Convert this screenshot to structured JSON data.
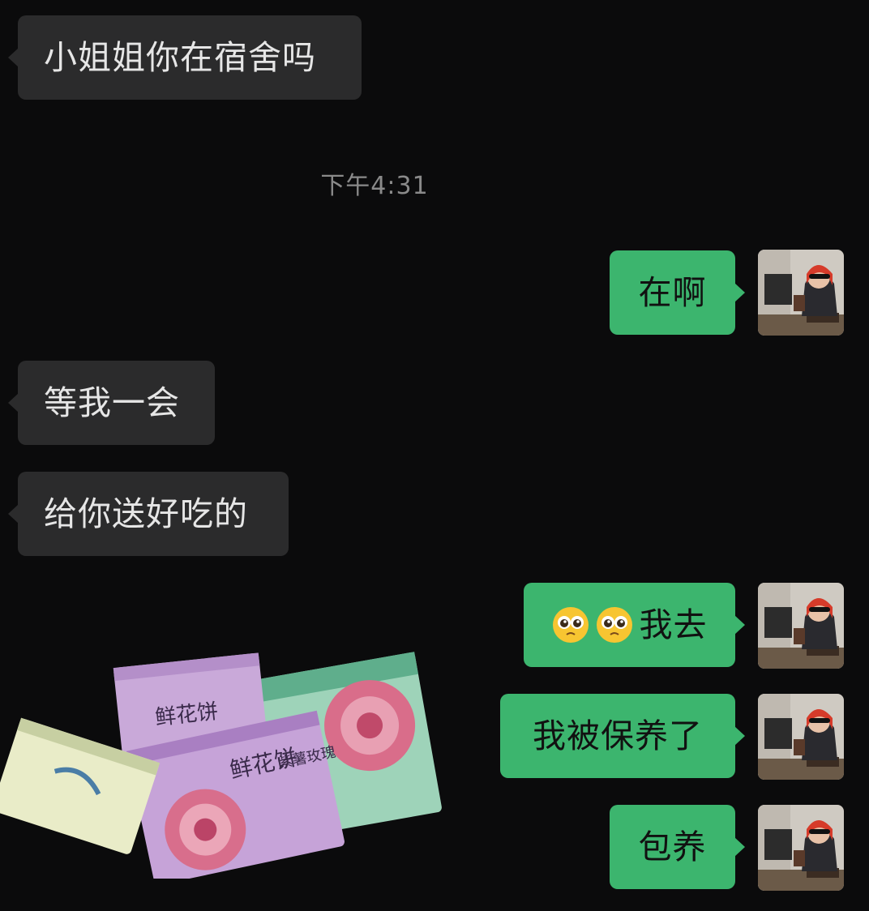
{
  "messages": [
    {
      "side": "in",
      "text": "小姐姐你在宿舍吗"
    },
    {
      "side": "out",
      "text": "在啊"
    },
    {
      "side": "in",
      "text": "等我一会"
    },
    {
      "side": "in",
      "text": "给你送好吃的"
    },
    {
      "side": "out",
      "text": "我去",
      "emoji": [
        "pleading-face-icon",
        "pleading-face-icon"
      ]
    },
    {
      "side": "out",
      "text": "我被保养了"
    },
    {
      "side": "out",
      "text": "包养"
    }
  ],
  "timestamp": "下午4:31",
  "photo": {
    "description_icon": "sticker-photo-flower-cakes",
    "package_text": [
      "鲜花饼",
      "紫薯玫瑰"
    ]
  },
  "colors": {
    "background": "#0b0b0c",
    "incoming_bubble": "#2b2b2c",
    "outgoing_bubble": "#3cb56e",
    "timestamp": "#8a8a8a"
  }
}
